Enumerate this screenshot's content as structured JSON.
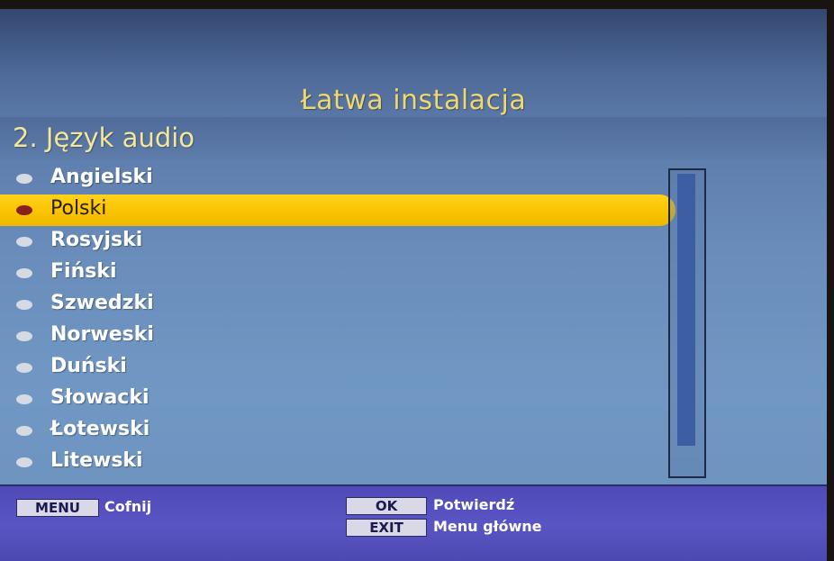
{
  "header": {
    "title": "Łatwa instalacja",
    "subtitle": "2. Język audio"
  },
  "languages": [
    {
      "label": "Angielski",
      "selected": false
    },
    {
      "label": "Polski",
      "selected": true
    },
    {
      "label": "Rosyjski",
      "selected": false
    },
    {
      "label": "Fiński",
      "selected": false
    },
    {
      "label": "Szwedzki",
      "selected": false
    },
    {
      "label": "Norweski",
      "selected": false
    },
    {
      "label": "Duński",
      "selected": false
    },
    {
      "label": "Słowacki",
      "selected": false
    },
    {
      "label": "Łotewski",
      "selected": false
    },
    {
      "label": "Litewski",
      "selected": false
    }
  ],
  "footer": {
    "menu_key": "MENU",
    "menu_label": "Cofnij",
    "ok_key": "OK",
    "ok_label": "Potwierdź",
    "exit_key": "EXIT",
    "exit_label": "Menu główne"
  },
  "colors": {
    "title": "#f1d86c",
    "highlight": "#f7c200",
    "footer": "#5a55c4"
  }
}
